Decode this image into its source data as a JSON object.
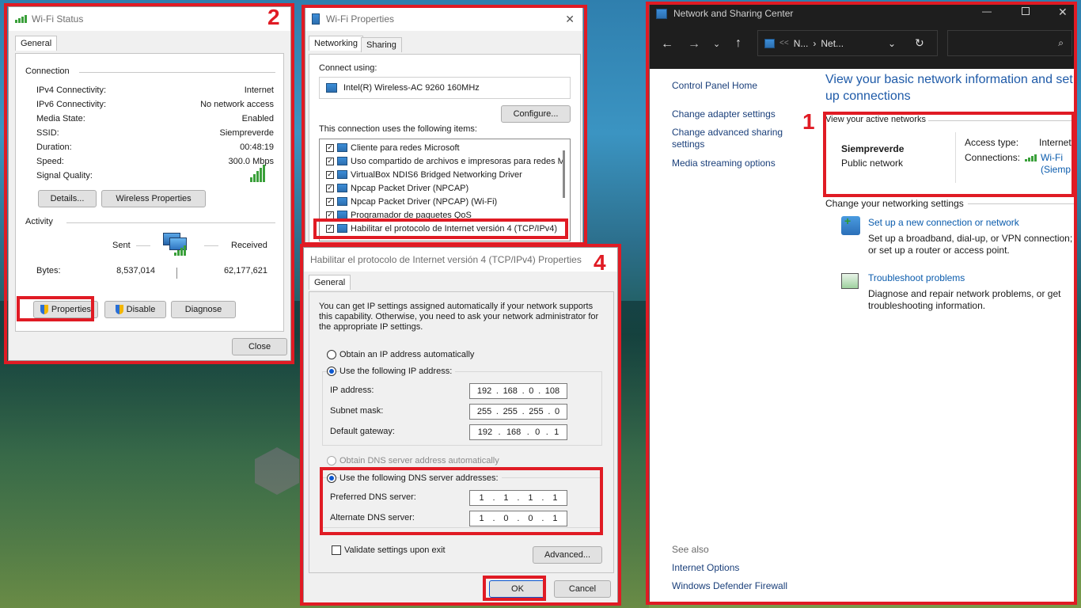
{
  "wifi_status": {
    "number": "2",
    "title": "Wi-Fi Status",
    "tab": "General",
    "connection_label": "Connection",
    "rows": [
      {
        "k": "IPv4 Connectivity:",
        "v": "Internet"
      },
      {
        "k": "IPv6 Connectivity:",
        "v": "No network access"
      },
      {
        "k": "Media State:",
        "v": "Enabled"
      },
      {
        "k": "SSID:",
        "v": "Siempreverde"
      },
      {
        "k": "Duration:",
        "v": "00:48:19"
      },
      {
        "k": "Speed:",
        "v": "300.0 Mbps"
      }
    ],
    "signal_label": "Signal Quality:",
    "details": "Details...",
    "wireless_props": "Wireless Properties",
    "activity_label": "Activity",
    "sent": "Sent",
    "received": "Received",
    "bytes": "Bytes:",
    "bytes_sent": "8,537,014",
    "bytes_recv": "62,177,621",
    "properties": "Properties",
    "disable": "Disable",
    "diagnose": "Diagnose",
    "close": "Close"
  },
  "wifi_props": {
    "title": "Wi-Fi Properties",
    "tab_networking": "Networking",
    "tab_sharing": "Sharing",
    "connect_using": "Connect using:",
    "adapter": "Intel(R) Wireless-AC 9260 160MHz",
    "configure": "Configure...",
    "items_label": "This connection uses the following items:",
    "items": [
      "Cliente para redes Microsoft",
      "Uso compartido de archivos e impresoras para redes M",
      "VirtualBox NDIS6 Bridged Networking Driver",
      "Npcap Packet Driver (NPCAP)",
      "Npcap Packet Driver (NPCAP) (Wi-Fi)",
      "Programador de paquetes QoS",
      "Habilitar el protocolo de Internet versión 4 (TCP/IPv4)"
    ]
  },
  "ipv4": {
    "number": "4",
    "title": "Habilitar el protocolo de Internet versión 4 (TCP/IPv4) Properties",
    "tab": "General",
    "desc": "You can get IP settings assigned automatically if your network supports this capability. Otherwise, you need to ask your network administrator for the appropriate IP settings.",
    "auto_ip": "Obtain an IP address automatically",
    "use_ip": "Use the following IP address:",
    "ip_label": "IP address:",
    "ip": [
      "192",
      "168",
      "0",
      "108"
    ],
    "mask_label": "Subnet mask:",
    "mask": [
      "255",
      "255",
      "255",
      "0"
    ],
    "gw_label": "Default gateway:",
    "gw": [
      "192",
      "168",
      "0",
      "1"
    ],
    "auto_dns": "Obtain DNS server address automatically",
    "use_dns": "Use the following DNS server addresses:",
    "pdns_label": "Preferred DNS server:",
    "pdns": [
      "1",
      "1",
      "1",
      "1"
    ],
    "adns_label": "Alternate DNS server:",
    "adns": [
      "1",
      "0",
      "0",
      "1"
    ],
    "validate": "Validate settings upon exit",
    "advanced": "Advanced...",
    "ok": "OK",
    "cancel": "Cancel"
  },
  "nsc": {
    "number": "1",
    "title": "Network and Sharing Center",
    "crumb1": "N...",
    "crumb2": "Net...",
    "sep": "<<",
    "control_home": "Control Panel Home",
    "change_adapter": "Change adapter settings",
    "change_sharing": "Change advanced sharing settings",
    "media": "Media streaming options",
    "heading": "View your basic network information and set up connections",
    "active_networks": "View your active networks",
    "net_name": "Siempreverde",
    "net_type": "Public network",
    "access_type_label": "Access type:",
    "access_type": "Internet",
    "connections_label": "Connections:",
    "conn_link": "Wi-Fi",
    "conn_sub": "(Siemp",
    "change_settings": "Change your networking settings",
    "setup_link": "Set up a new connection or network",
    "setup_desc": "Set up a broadband, dial-up, or VPN connection; or set up a router or access point.",
    "trouble_link": "Troubleshoot problems",
    "trouble_desc": "Diagnose and repair network problems, or get troubleshooting information.",
    "see_also": "See also",
    "internet_options": "Internet Options",
    "firewall": "Windows Defender Firewall"
  }
}
